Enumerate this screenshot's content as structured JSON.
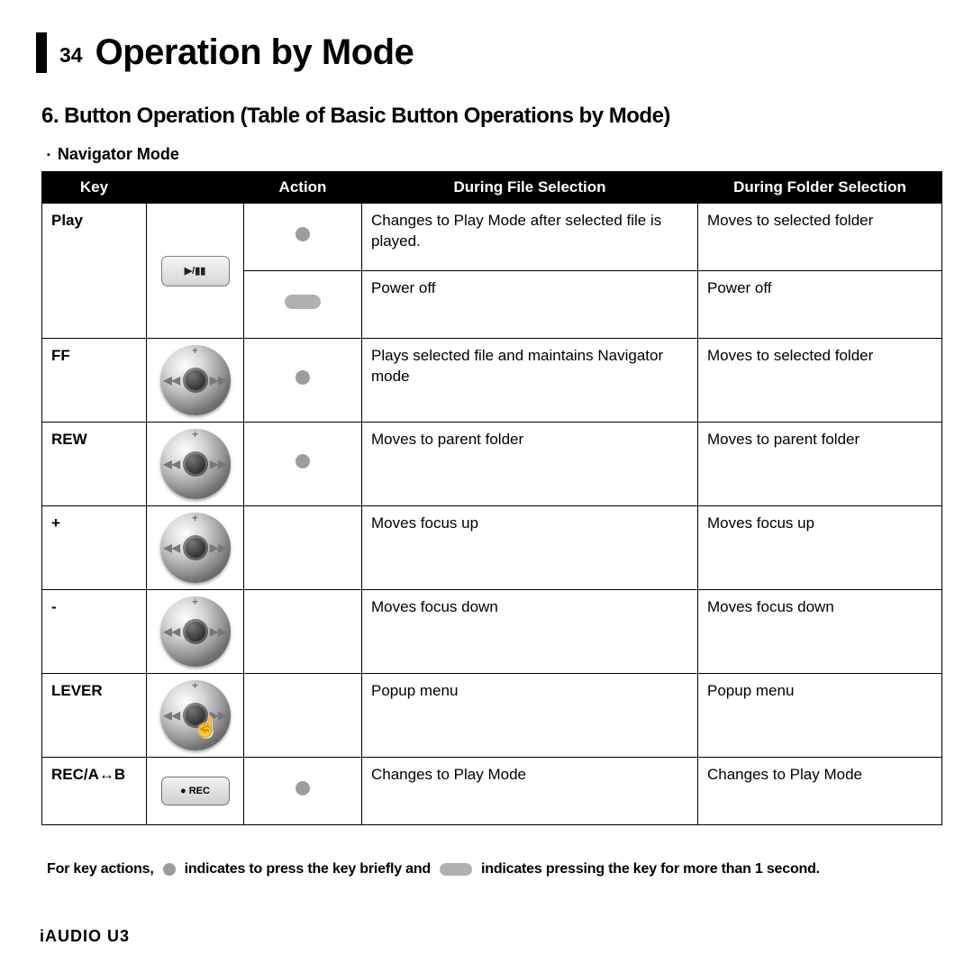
{
  "page_number": "34",
  "title": "Operation by Mode",
  "section_title": "6. Button Operation (Table of Basic Button Operations by Mode)",
  "subsection": "Navigator Mode",
  "table": {
    "headers": [
      "Key",
      "",
      "Action",
      "During File Selection",
      "During Folder Selection"
    ],
    "rows": [
      {
        "key": "Play",
        "icon": "play",
        "action": "dot",
        "file": "Changes to Play Mode after selected file is played.",
        "folder": "Moves to selected folder"
      },
      {
        "key": "",
        "icon": "",
        "action": "cap",
        "file": "Power off",
        "folder": "Power off"
      },
      {
        "key": "FF",
        "icon": "jog",
        "action": "dot",
        "file": "Plays selected file and maintains Navigator mode",
        "folder": "Moves to selected folder"
      },
      {
        "key": "REW",
        "icon": "jog",
        "action": "dot",
        "file": "Moves to parent folder",
        "folder": "Moves to parent folder"
      },
      {
        "key": "+",
        "icon": "jog",
        "action": "",
        "file": "Moves focus up",
        "folder": "Moves focus up"
      },
      {
        "key": "-",
        "icon": "jog",
        "action": "",
        "file": "Moves focus down",
        "folder": "Moves focus down"
      },
      {
        "key": "LEVER",
        "icon": "jog-press",
        "action": "",
        "file": "Popup menu",
        "folder": "Popup menu"
      },
      {
        "key": "REC/A↔B",
        "icon": "rec",
        "action": "dot",
        "file": "Changes to Play Mode",
        "folder": "Changes to Play Mode"
      }
    ]
  },
  "play_glyph": "▶/▮▮",
  "rec_glyph": "● REC",
  "legend": {
    "prefix": "For key actions,",
    "short": "indicates to press the key briefly and",
    "long": "indicates pressing the key for more than 1 second."
  },
  "footer": "iAUDIO U3"
}
